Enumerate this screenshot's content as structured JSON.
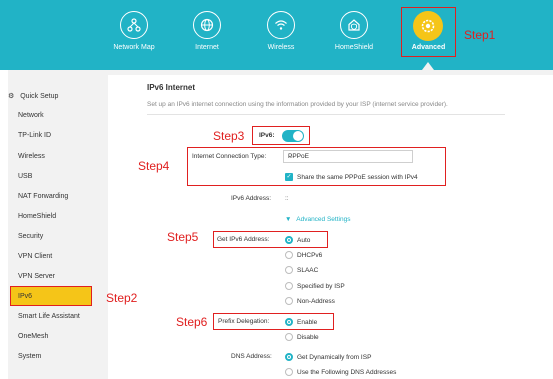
{
  "nav": {
    "items": [
      {
        "label": "Network Map",
        "icon": "network-map-icon"
      },
      {
        "label": "Internet",
        "icon": "globe-icon"
      },
      {
        "label": "Wireless",
        "icon": "wifi-icon"
      },
      {
        "label": "HomeShield",
        "icon": "home-shield-icon"
      },
      {
        "label": "Advanced",
        "icon": "gear-icon"
      }
    ]
  },
  "steps": {
    "step1": "Step1",
    "step2": "Step2",
    "step3": "Step3",
    "step4": "Step4",
    "step5": "Step5",
    "step6": "Step6"
  },
  "sidebar": {
    "items": [
      {
        "label": "Quick Setup"
      },
      {
        "label": "Network"
      },
      {
        "label": "TP-Link ID"
      },
      {
        "label": "Wireless"
      },
      {
        "label": "USB"
      },
      {
        "label": "NAT Forwarding"
      },
      {
        "label": "HomeShield"
      },
      {
        "label": "Security"
      },
      {
        "label": "VPN Client"
      },
      {
        "label": "VPN Server"
      },
      {
        "label": "IPv6"
      },
      {
        "label": "Smart Life Assistant"
      },
      {
        "label": "OneMesh"
      },
      {
        "label": "System"
      }
    ]
  },
  "main": {
    "title": "IPv6 Internet",
    "description": "Set up an IPv6 internet connection using the information provided by your ISP (internet service provider).",
    "ipv6_label": "IPv6:",
    "ipv6_enabled": true,
    "connection_type_label": "Internet Connection Type:",
    "connection_type_value": "PPPoE",
    "share_session_label": "Share the same PPPoE session with IPv4",
    "share_session_checked": true,
    "ipv6_address_label": "IPv6 Address:",
    "ipv6_address_value": "::",
    "advanced_settings_label": "Advanced Settings",
    "get_ipv6_address_label": "Get IPv6 Address:",
    "get_ipv6_address_options": [
      "Auto",
      "DHCPv6",
      "SLAAC",
      "Specified by ISP",
      "Non-Address"
    ],
    "get_ipv6_address_selected": "Auto",
    "prefix_delegation_label": "Prefix Delegation:",
    "prefix_delegation_options": [
      "Enable",
      "Disable"
    ],
    "prefix_delegation_selected": "Enable",
    "dns_address_label": "DNS Address:",
    "dns_address_options": [
      "Get Dynamically from ISP",
      "Use the Following DNS Addresses"
    ],
    "dns_address_selected": "Get Dynamically from ISP"
  },
  "colors": {
    "accent": "#21b3c6",
    "highlight": "#f5c518",
    "annotation": "#e02020"
  }
}
